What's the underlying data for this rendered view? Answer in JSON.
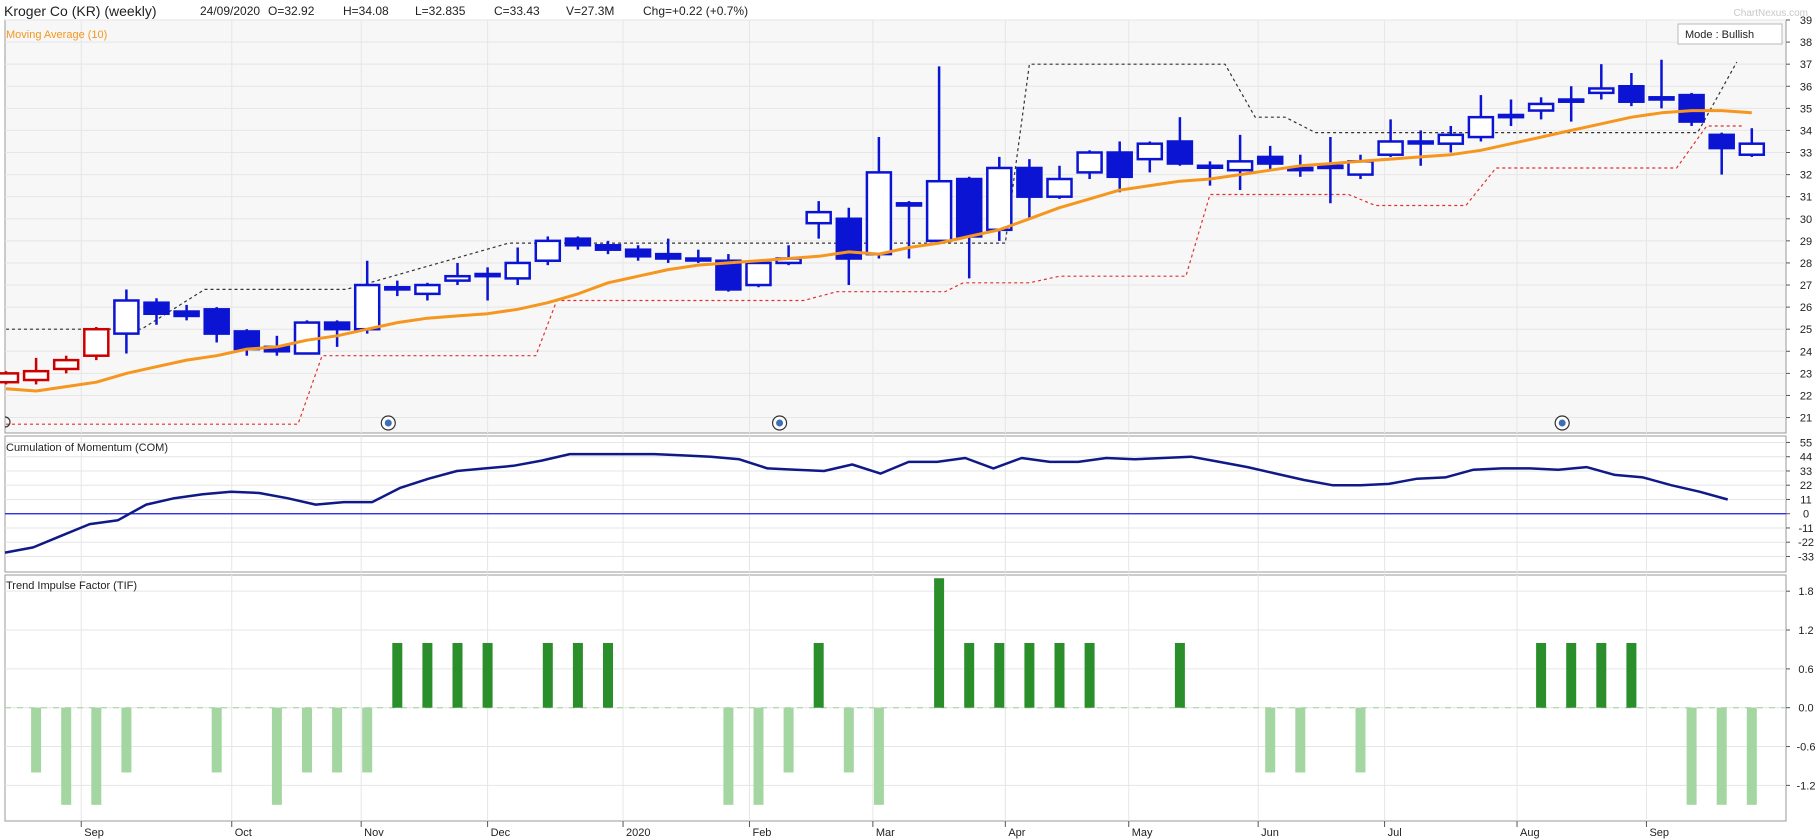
{
  "header": {
    "title": "Kroger Co (KR) (weekly)",
    "date": "24/09/2020",
    "open": "O=32.92",
    "high": "H=34.08",
    "low": "L=32.835",
    "close": "C=33.43",
    "volume": "V=27.3M",
    "change": "Chg=+0.22 (+0.7%)",
    "watermark": "ChartNexus.com"
  },
  "colors": {
    "up": "#0a14d2",
    "down": "#0a14d2",
    "early": "#cc0000",
    "ma": "#f5961e",
    "com": "#0f1987",
    "tif_strong": "#2a8f2a",
    "tif_weak": "#a3d6a0",
    "grid": "#e6e6e6",
    "background": "#f7f7f7"
  },
  "chart_data": [
    {
      "type": "candlestick",
      "panel": "price",
      "label": "Moving Average (10)",
      "mode_label": "Mode : Bullish",
      "x_labels": [
        "Sep",
        "Oct",
        "Nov",
        "Dec",
        "2020",
        "Feb",
        "Mar",
        "Apr",
        "May",
        "Jun",
        "Jul",
        "Aug",
        "Sep"
      ],
      "x_label_weeks": [
        2.5,
        7.5,
        11.8,
        16,
        20.5,
        24.7,
        28.8,
        33.2,
        37.3,
        41.6,
        45.8,
        50.2,
        54.5
      ],
      "ylim": [
        20.3,
        39
      ],
      "yticks": [
        21,
        22,
        23,
        24,
        25,
        26,
        27,
        28,
        29,
        30,
        31,
        32,
        33,
        34,
        35,
        36,
        37,
        38,
        39
      ],
      "grid": true,
      "ohlc": [
        [
          22.6,
          23.1,
          22.5,
          23.0
        ],
        [
          22.7,
          23.7,
          22.5,
          23.1
        ],
        [
          23.2,
          23.8,
          23.0,
          23.6
        ],
        [
          23.8,
          25.1,
          23.6,
          25.0
        ],
        [
          24.8,
          26.8,
          23.9,
          26.3
        ],
        [
          26.2,
          26.4,
          25.2,
          25.7
        ],
        [
          25.8,
          26.1,
          25.4,
          25.6
        ],
        [
          25.9,
          26.0,
          24.4,
          24.8
        ],
        [
          24.9,
          25.0,
          23.8,
          24.1
        ],
        [
          24.2,
          24.7,
          23.8,
          24.0
        ],
        [
          23.9,
          25.4,
          23.9,
          25.3
        ],
        [
          25.3,
          25.4,
          24.2,
          25.0
        ],
        [
          25.0,
          28.1,
          24.8,
          27.0
        ],
        [
          26.8,
          27.2,
          26.5,
          26.9
        ],
        [
          26.6,
          27.1,
          26.3,
          27.0
        ],
        [
          27.2,
          28.0,
          27.0,
          27.4
        ],
        [
          27.4,
          27.8,
          26.3,
          27.5
        ],
        [
          27.3,
          28.7,
          27.0,
          28.0
        ],
        [
          28.1,
          29.2,
          27.9,
          29.0
        ],
        [
          29.1,
          29.2,
          28.6,
          28.8
        ],
        [
          28.8,
          29.0,
          28.4,
          28.6
        ],
        [
          28.6,
          28.8,
          28.1,
          28.3
        ],
        [
          28.4,
          29.1,
          28.0,
          28.2
        ],
        [
          28.2,
          28.6,
          28.0,
          28.2
        ],
        [
          28.1,
          28.4,
          26.7,
          26.8
        ],
        [
          27.0,
          28.1,
          26.9,
          28.0
        ],
        [
          28.0,
          28.8,
          27.9,
          28.2
        ],
        [
          29.8,
          30.8,
          29.1,
          30.3
        ],
        [
          30.0,
          30.5,
          27.0,
          28.2
        ],
        [
          28.4,
          33.7,
          28.2,
          32.1
        ],
        [
          30.7,
          30.8,
          28.2,
          30.6
        ],
        [
          29.0,
          36.9,
          28.9,
          31.7
        ],
        [
          31.8,
          31.9,
          27.3,
          29.2
        ],
        [
          29.5,
          32.8,
          29.0,
          32.3
        ],
        [
          32.3,
          32.7,
          30.0,
          31.0
        ],
        [
          31.0,
          32.4,
          30.9,
          31.8
        ],
        [
          32.1,
          33.1,
          31.8,
          33.0
        ],
        [
          33.0,
          33.5,
          31.2,
          31.9
        ],
        [
          32.7,
          33.5,
          32.1,
          33.4
        ],
        [
          33.5,
          34.6,
          32.4,
          32.5
        ],
        [
          32.4,
          32.6,
          31.5,
          32.4
        ],
        [
          32.2,
          33.8,
          31.3,
          32.6
        ],
        [
          32.8,
          33.3,
          32.2,
          32.5
        ],
        [
          32.3,
          32.9,
          31.9,
          32.2
        ],
        [
          32.3,
          33.7,
          30.7,
          32.4
        ],
        [
          32.0,
          32.9,
          31.8,
          32.6
        ],
        [
          32.9,
          34.5,
          32.8,
          33.5
        ],
        [
          33.5,
          34.0,
          32.4,
          33.5
        ],
        [
          33.4,
          34.2,
          33.0,
          33.8
        ],
        [
          33.7,
          35.6,
          33.5,
          34.6
        ],
        [
          34.7,
          35.4,
          34.2,
          34.6
        ],
        [
          34.9,
          35.5,
          34.5,
          35.2
        ],
        [
          35.3,
          36.0,
          34.4,
          35.4
        ],
        [
          35.7,
          37.0,
          35.4,
          35.9
        ],
        [
          36.0,
          36.6,
          35.1,
          35.3
        ],
        [
          35.4,
          37.2,
          35.0,
          35.5
        ],
        [
          35.6,
          35.7,
          34.2,
          34.4
        ],
        [
          33.8,
          33.9,
          32.0,
          33.2
        ],
        [
          32.9,
          34.1,
          32.8,
          33.4
        ]
      ],
      "ma10": [
        22.3,
        22.2,
        22.4,
        22.6,
        23.0,
        23.3,
        23.6,
        23.8,
        24.1,
        24.2,
        24.5,
        24.7,
        25.0,
        25.3,
        25.5,
        25.6,
        25.7,
        25.9,
        26.2,
        26.6,
        27.1,
        27.4,
        27.7,
        27.9,
        28.0,
        28.1,
        28.2,
        28.3,
        28.5,
        28.4,
        28.7,
        28.9,
        29.2,
        29.5,
        30.0,
        30.5,
        30.9,
        31.3,
        31.5,
        31.7,
        31.8,
        32.0,
        32.2,
        32.4,
        32.5,
        32.6,
        32.7,
        32.8,
        32.9,
        33.1,
        33.4,
        33.7,
        34.0,
        34.3,
        34.6,
        34.8,
        34.9,
        34.9,
        34.8
      ],
      "upper_stop": [
        [
          0,
          25.0
        ],
        [
          4.5,
          25.0
        ],
        [
          6.6,
          26.8
        ],
        [
          11.3,
          26.8
        ],
        [
          14.4,
          28.0
        ],
        [
          16.7,
          28.9
        ],
        [
          24.5,
          28.9
        ],
        [
          26.6,
          28.9
        ],
        [
          33.2,
          28.9
        ],
        [
          34.0,
          37.0
        ],
        [
          40.5,
          37.0
        ],
        [
          41.5,
          34.6
        ],
        [
          42.5,
          34.6
        ],
        [
          43.5,
          33.9
        ],
        [
          56.2,
          33.9
        ],
        [
          57.5,
          37.1
        ]
      ],
      "lower_stop": [
        [
          0,
          20.7
        ],
        [
          9.7,
          20.7
        ],
        [
          10.5,
          23.8
        ],
        [
          17.6,
          23.8
        ],
        [
          18.3,
          26.3
        ],
        [
          26.5,
          26.3
        ],
        [
          27.6,
          26.7
        ],
        [
          31.2,
          26.7
        ],
        [
          31.8,
          27.1
        ],
        [
          34.0,
          27.1
        ],
        [
          35.0,
          27.4
        ],
        [
          39.2,
          27.4
        ],
        [
          40.0,
          31.1
        ],
        [
          44.6,
          31.1
        ],
        [
          45.5,
          30.6
        ],
        [
          48.5,
          30.6
        ],
        [
          49.5,
          32.3
        ],
        [
          55.5,
          32.3
        ],
        [
          56.5,
          34.2
        ],
        [
          57.7,
          34.2
        ]
      ],
      "events_weeks": [
        12.7,
        25.7,
        51.7
      ]
    },
    {
      "type": "line",
      "panel": "com",
      "label": "Cumulation of Momentum (COM)",
      "yticks": [
        -33,
        -22,
        -11,
        0,
        11,
        22,
        33,
        44,
        55
      ],
      "ylim": [
        -45,
        60
      ],
      "values": [
        -30,
        -26,
        -17,
        -8,
        -5,
        7,
        12,
        15,
        17,
        16,
        12,
        7,
        9,
        9,
        20,
        27,
        33,
        35,
        37,
        41,
        46,
        46,
        46,
        46,
        45,
        44,
        42,
        35,
        34,
        33,
        38,
        31,
        40,
        40,
        43,
        35,
        43,
        40,
        40,
        43,
        42,
        43,
        44,
        40,
        36,
        31,
        26,
        22,
        22,
        23,
        27,
        28,
        34,
        35,
        35,
        34,
        36,
        30,
        28,
        22,
        17,
        11
      ]
    },
    {
      "type": "bar",
      "panel": "tif",
      "label": "Trend Impulse Factor (TIF)",
      "yticks": [
        -1.2,
        -0.6,
        -0.0,
        0.6,
        1.2,
        1.8
      ],
      "ylim": [
        -1.75,
        2.05
      ],
      "values": [
        0,
        -1.0,
        -1.5,
        -1.5,
        -1.0,
        0,
        0,
        -1.0,
        0,
        -1.5,
        -1.0,
        -1.0,
        -1.0,
        1.0,
        1.0,
        1.0,
        1.0,
        0,
        1.0,
        1.0,
        1.0,
        0,
        0,
        0,
        -1.5,
        -1.5,
        -1.0,
        1.0,
        -1.0,
        -1.5,
        0,
        2.0,
        1.0,
        1.0,
        1.0,
        1.0,
        1.0,
        0,
        0,
        1.0,
        0,
        0,
        -1.0,
        -1.0,
        0,
        -1.0,
        0,
        0,
        0,
        0,
        0,
        1.0,
        1.0,
        1.0,
        1.0,
        0,
        -1.5,
        -1.5,
        -1.5
      ]
    }
  ]
}
